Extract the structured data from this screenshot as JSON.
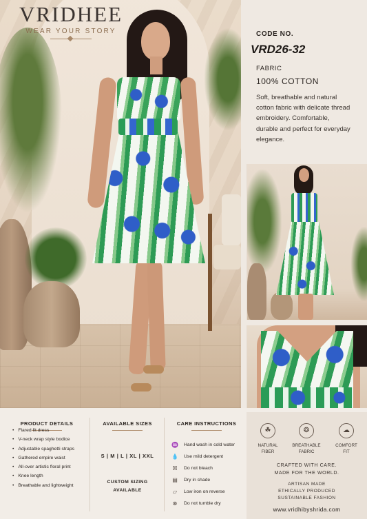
{
  "brand": {
    "name": "VRIDHEE",
    "tagline": "WEAR YOUR STORY"
  },
  "product": {
    "code_label": "CODE NO.",
    "code": "VRD26-32",
    "fabric_label": "FABRIC",
    "fabric": "100% COTTON",
    "description": "Soft, breathable and natural cotton fabric with delicate thread embroidery. Comfortable, durable and perfect for everyday elegance."
  },
  "product_details": {
    "title": "PRODUCT DETAILS",
    "items": [
      "Flared fit dress",
      "V-neck wrap style bodice",
      "Adjustable spaghetti straps",
      "Gathered empire waist",
      "All-over artistic floral print",
      "Knee length",
      "Breathable and lightweight"
    ]
  },
  "sizes": {
    "title": "AVAILABLE SIZES",
    "list": "S | M | L | XL | XXL",
    "custom_line1": "CUSTOM SIZING",
    "custom_line2": "AVAILABLE"
  },
  "care": {
    "title": "CARE INSTRUCTIONS",
    "items": [
      {
        "icon": "hand-wash-icon",
        "text": "Hand wash in cold water"
      },
      {
        "icon": "detergent-icon",
        "text": "Use mild detergent"
      },
      {
        "icon": "no-bleach-icon",
        "text": "Do not bleach"
      },
      {
        "icon": "dry-shade-icon",
        "text": "Dry in shade"
      },
      {
        "icon": "low-iron-icon",
        "text": "Low iron on reverse"
      },
      {
        "icon": "no-tumble-dry-icon",
        "text": "Do not tumble dry"
      }
    ]
  },
  "badges": [
    {
      "icon": "leaf-icon",
      "line1": "NATURAL",
      "line2": "FIBER"
    },
    {
      "icon": "feather-icon",
      "line1": "BREATHABLE",
      "line2": "FABRIC"
    },
    {
      "icon": "cloud-icon",
      "line1": "COMFORT",
      "line2": "FIT"
    }
  ],
  "footer": {
    "crafted_line1": "CRAFTED WITH CARE.",
    "crafted_line2": "MADE FOR THE WORLD.",
    "artisan_line1": "ARTISAN MADE",
    "artisan_line2": "ETHICALLY PRODUCED",
    "artisan_line3": "SUSTAINABLE FASHION",
    "website": "www.vridhibyshrida.com"
  },
  "colors": {
    "accent": "#a8896a",
    "dress_blue": "#2f5ec8",
    "dress_green": "#2d9b55",
    "background": "#efe9e2"
  }
}
